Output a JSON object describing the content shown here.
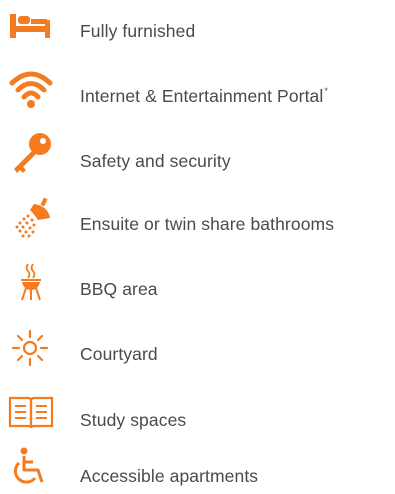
{
  "accent_color": "#f47b20",
  "text_color": "#4a4a4a",
  "features": [
    {
      "icon": "bed-icon",
      "label": "Fully furnished",
      "note": ""
    },
    {
      "icon": "wifi-icon",
      "label": "Internet & Entertainment Portal",
      "note": "*"
    },
    {
      "icon": "key-icon",
      "label": "Safety and security",
      "note": ""
    },
    {
      "icon": "shower-icon",
      "label": "Ensuite or twin share bathrooms",
      "note": ""
    },
    {
      "icon": "bbq-icon",
      "label": "BBQ area",
      "note": ""
    },
    {
      "icon": "sun-icon",
      "label": "Courtyard",
      "note": ""
    },
    {
      "icon": "book-icon",
      "label": "Study spaces",
      "note": ""
    },
    {
      "icon": "wheelchair-icon",
      "label": "Accessible apartments",
      "note": ""
    }
  ]
}
